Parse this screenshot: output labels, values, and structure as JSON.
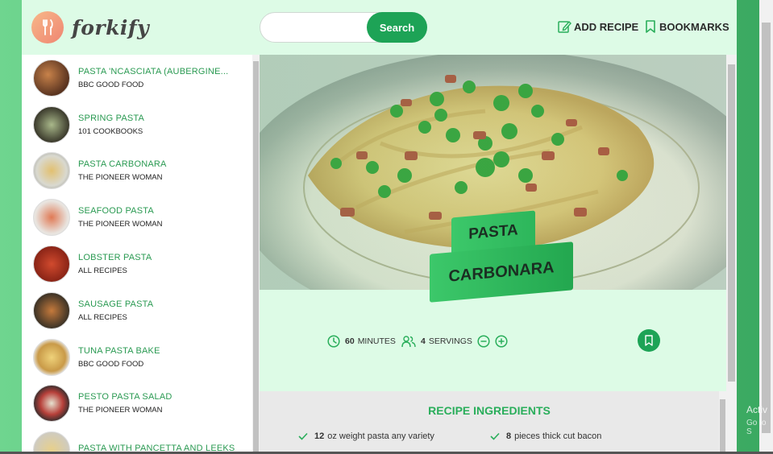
{
  "app": {
    "name": "forkify"
  },
  "header": {
    "search_placeholder": "",
    "search_button": "Search",
    "add_recipe": "ADD RECIPE",
    "bookmarks": "BOOKMARKS"
  },
  "sidebar": {
    "items": [
      {
        "title": "PASTA 'NCASCIATA (AUBERGINE...",
        "publisher": "BBC GOOD FOOD"
      },
      {
        "title": "SPRING PASTA",
        "publisher": "101 COOKBOOKS"
      },
      {
        "title": "PASTA CARBONARA",
        "publisher": "THE PIONEER WOMAN"
      },
      {
        "title": "SEAFOOD PASTA",
        "publisher": "THE PIONEER WOMAN"
      },
      {
        "title": "LOBSTER PASTA",
        "publisher": "ALL RECIPES"
      },
      {
        "title": "SAUSAGE PASTA",
        "publisher": "ALL RECIPES"
      },
      {
        "title": "TUNA PASTA BAKE",
        "publisher": "BBC GOOD FOOD"
      },
      {
        "title": "PESTO PASTA SALAD",
        "publisher": "THE PIONEER WOMAN"
      },
      {
        "title": "PASTA WITH PANCETTA AND LEEKS",
        "publisher": ""
      }
    ]
  },
  "recipe": {
    "title_line1": "PASTA",
    "title_line2": "CARBONARA",
    "cooking_time": "60",
    "cooking_time_unit": "MINUTES",
    "servings": "4",
    "servings_unit": "SERVINGS"
  },
  "ingredients": {
    "heading": "RECIPE INGREDIENTS",
    "items": [
      {
        "quantity": "12",
        "description": "oz weight pasta any variety"
      },
      {
        "quantity": "8",
        "description": "pieces thick cut bacon"
      }
    ]
  },
  "watermark": {
    "line1": "Activ",
    "line2": "Go to S"
  },
  "colors": {
    "accent": "#1da356",
    "title_green": "#2aae5b",
    "background": "#ddfbe6"
  }
}
